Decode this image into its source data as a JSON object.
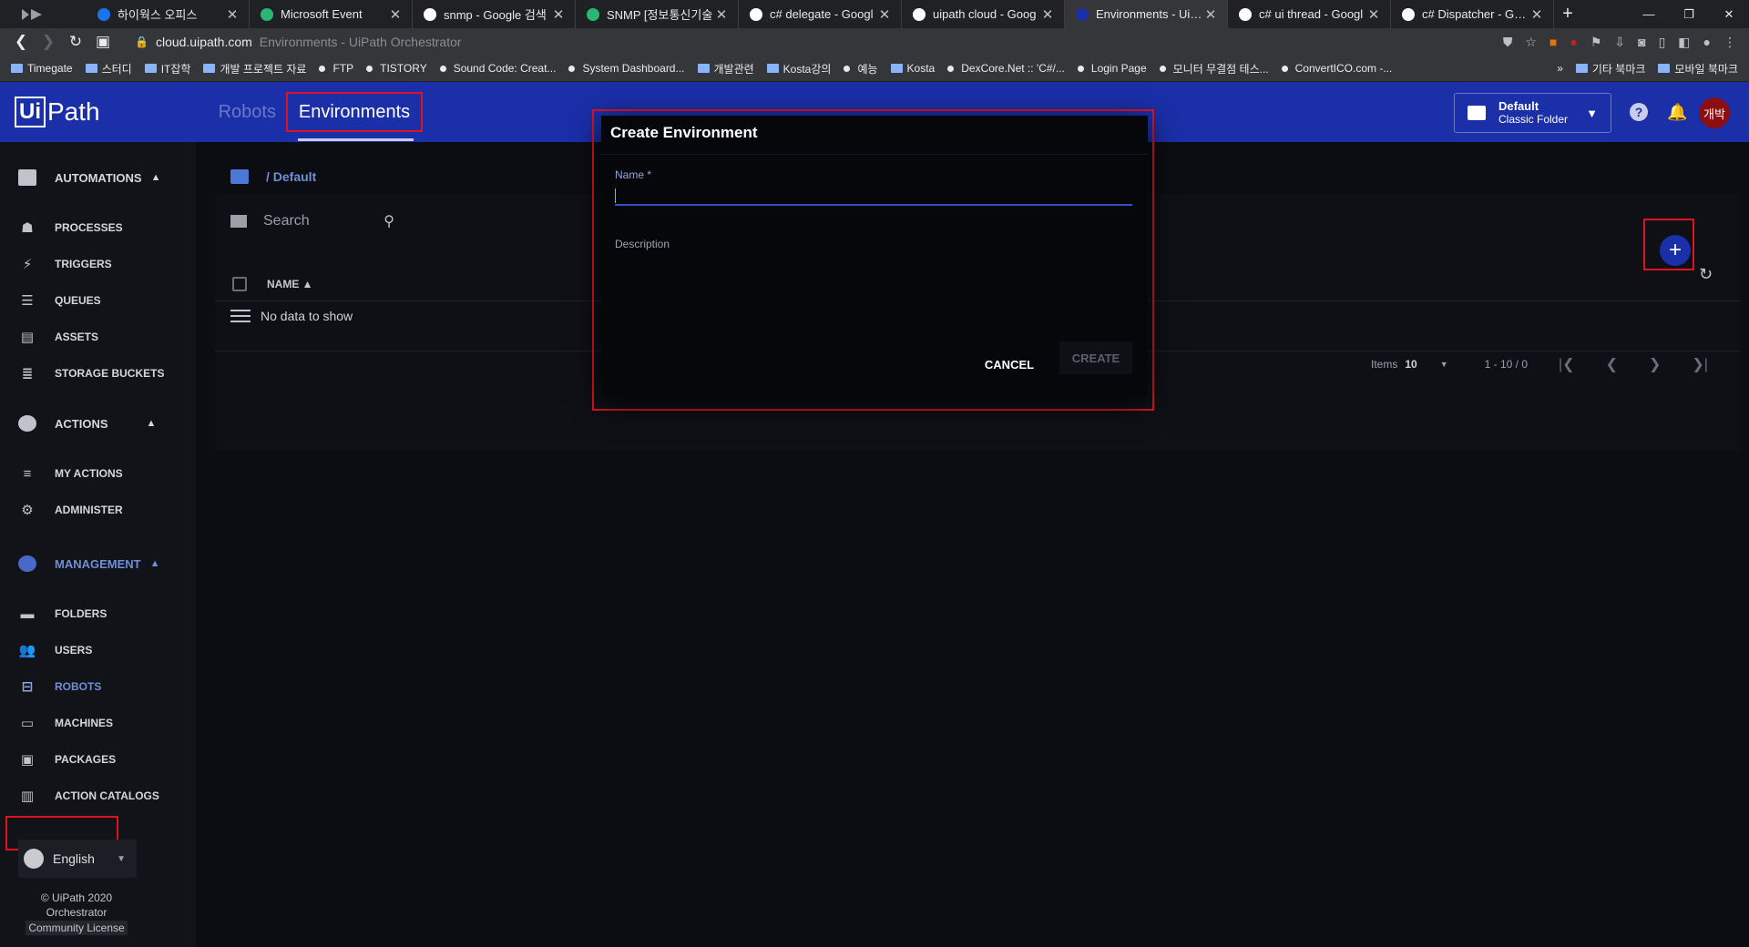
{
  "browser": {
    "tabs": [
      {
        "title": "하이웍스 오피스",
        "favicon_color": "#1a73e8"
      },
      {
        "title": "Microsoft Event",
        "favicon_color": "#2bb673"
      },
      {
        "title": "snmp - Google 검색",
        "favicon_color": "#ffffff"
      },
      {
        "title": "SNMP [정보통신기술",
        "favicon_color": "#2bb673"
      },
      {
        "title": "c# delegate - Googl",
        "favicon_color": "#ffffff"
      },
      {
        "title": "uipath cloud - Goog",
        "favicon_color": "#ffffff"
      },
      {
        "title": "Environments - UiPat",
        "favicon_color": "#1a2fa8",
        "active": true
      },
      {
        "title": "c# ui thread - Googl",
        "favicon_color": "#ffffff"
      },
      {
        "title": "c# Dispatcher - Goog",
        "favicon_color": "#ffffff"
      }
    ],
    "url_host": "cloud.uipath.com",
    "url_page_title": "Environments - UiPath Orchestrator",
    "bookmarks": [
      {
        "label": "Timegate",
        "kind": "folder"
      },
      {
        "label": "스터디",
        "kind": "folder"
      },
      {
        "label": "IT잡학",
        "kind": "folder"
      },
      {
        "label": "개발 프로젝트 자료",
        "kind": "folder"
      },
      {
        "label": "FTP",
        "kind": "dot"
      },
      {
        "label": "TISTORY",
        "kind": "dot"
      },
      {
        "label": "Sound Code: Creat...",
        "kind": "dot"
      },
      {
        "label": "System Dashboard...",
        "kind": "dot"
      },
      {
        "label": "개발관련",
        "kind": "folder"
      },
      {
        "label": "Kosta강의",
        "kind": "folder"
      },
      {
        "label": "예능",
        "kind": "dot"
      },
      {
        "label": "Kosta",
        "kind": "folder"
      },
      {
        "label": "DexCore.Net :: 'C#/...",
        "kind": "dot"
      },
      {
        "label": "Login Page",
        "kind": "dot"
      },
      {
        "label": "모니터 무결점 테스...",
        "kind": "dot"
      },
      {
        "label": "ConvertICO.com -...",
        "kind": "dot"
      }
    ],
    "bookmarks_right": [
      "기타 북마크",
      "모바일 북마크"
    ]
  },
  "header": {
    "logo_box": "Ui",
    "logo_text": "Path",
    "tab_robots": "Robots",
    "tab_environments": "Environments",
    "folder_name": "Default",
    "folder_type": "Classic Folder",
    "help": "?",
    "avatar_text": "개박"
  },
  "sidebar": {
    "automations": "AUTOMATIONS",
    "processes": "PROCESSES",
    "triggers": "TRIGGERS",
    "queues": "QUEUES",
    "assets": "ASSETS",
    "storage_buckets": "STORAGE BUCKETS",
    "actions": "ACTIONS",
    "my_actions": "MY ACTIONS",
    "administer": "ADMINISTER",
    "management": "MANAGEMENT",
    "folders": "FOLDERS",
    "users": "USERS",
    "robots": "ROBOTS",
    "machines": "MACHINES",
    "packages": "PACKAGES",
    "action_catalogs": "ACTION CATALOGS",
    "language": "English",
    "copyright_line1": "© UiPath 2020",
    "copyright_line2": "Orchestrator",
    "license": "Community License"
  },
  "main": {
    "breadcrumb": "/ Default",
    "search_placeholder": "Search",
    "col_name": "NAME",
    "empty_text": "No data to show",
    "items_label": "Items",
    "items_per_page": "10",
    "range": "1 - 10 / 0"
  },
  "dialog": {
    "title": "Create Environment",
    "name_label": "Name *",
    "name_value": "",
    "description_label": "Description",
    "cancel": "CANCEL",
    "create": "CREATE"
  },
  "colors": {
    "header_bg": "#1a2fa8",
    "highlight": "#e0141f",
    "accent": "#6f8fd8"
  }
}
